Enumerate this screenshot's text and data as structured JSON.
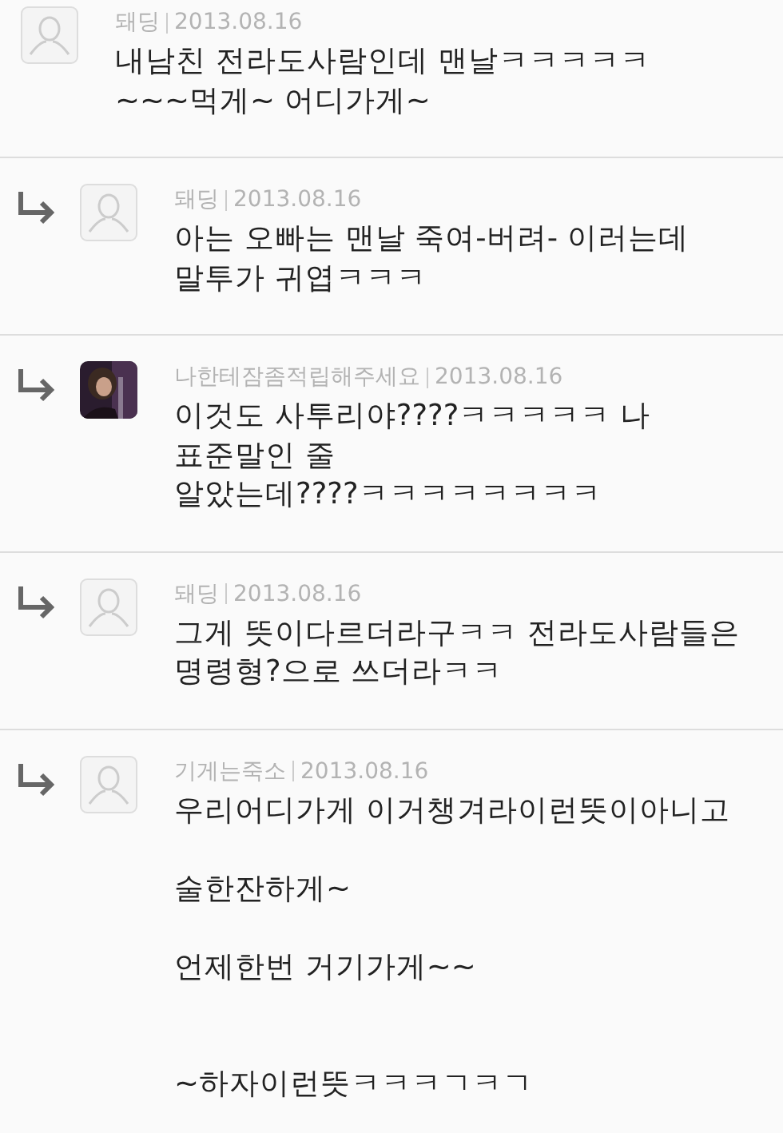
{
  "comments": [
    {
      "reply": false,
      "avatar": {
        "kind": "default"
      },
      "author": "돼딩",
      "date": "2013.08.16",
      "body": "내남친 전라도사람인데 맨날ㅋㅋㅋㅋㅋ\n~~~먹게~ 어디가게~"
    },
    {
      "reply": true,
      "avatar": {
        "kind": "default"
      },
      "author": "돼딩",
      "date": "2013.08.16",
      "body": "아는 오빠는 맨날 죽여-버려- 이러는데\n말투가 귀엽ㅋㅋㅋ"
    },
    {
      "reply": true,
      "author": "나한테잠좀적립해주세요",
      "date": "2013.08.16",
      "body": "이것도 사투리야????ㅋㅋㅋㅋㅋ 나\n표준말인 줄\n알았는데????ㅋㅋㅋㅋㅋㅋㅋㅋ"
    },
    {
      "reply": true,
      "avatar": {
        "kind": "default"
      },
      "author": "돼딩",
      "date": "2013.08.16",
      "body": "그게 뜻이다르더라구ㅋㅋ 전라도사람들은\n명령형?으로 쓰더라ㅋㅋ"
    },
    {
      "reply": true,
      "avatar": {
        "kind": "default"
      },
      "author": "기게는죽소",
      "date": "2013.08.16",
      "body": "우리어디가게 이거챙겨라이런뜻이아니고\n\n술한잔하게~\n\n언제한번 거기가게~~\n\n\n~하자이런뜻ㅋㅋㅋㄱㅋㄱ"
    }
  ]
}
